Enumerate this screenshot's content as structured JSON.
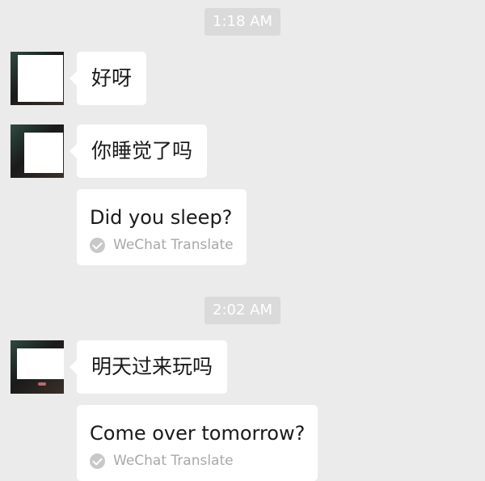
{
  "chat": {
    "timestamps": [
      "1:18 AM",
      "2:02 AM"
    ],
    "messages": [
      {
        "text": "好呀"
      },
      {
        "text": "你睡觉了吗",
        "translation": "Did you sleep?",
        "translate_label": "WeChat Translate"
      },
      {
        "text": "明天过来玩吗",
        "translation": "Come over tomorrow?",
        "translate_label": "WeChat Translate"
      }
    ]
  },
  "colors": {
    "background": "#ebebeb",
    "bubble": "#ffffff",
    "timestamp_bg": "#dadada",
    "muted_text": "#a8a8a8"
  }
}
